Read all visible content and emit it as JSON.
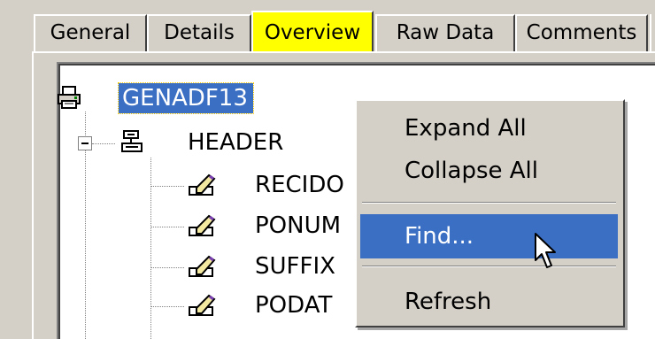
{
  "tabs": [
    {
      "label": "General"
    },
    {
      "label": "Details"
    },
    {
      "label": "Overview",
      "active": true
    },
    {
      "label": "Raw Data"
    },
    {
      "label": "Comments"
    }
  ],
  "tree": {
    "root": {
      "label": "GENADF13",
      "icon": "printer-icon",
      "selected": true
    },
    "header": {
      "label": "HEADER",
      "icon": "record-group-icon",
      "expanded": true
    },
    "fields": [
      {
        "label": "RECIDO",
        "icon": "field-edit-icon"
      },
      {
        "label": "PONUM",
        "icon": "field-edit-icon"
      },
      {
        "label": "SUFFIX",
        "icon": "field-edit-icon"
      },
      {
        "label": "PODAT",
        "icon": "field-edit-icon"
      }
    ]
  },
  "context_menu": {
    "items": [
      {
        "label": "Expand All"
      },
      {
        "label": "Collapse All"
      },
      {
        "label": "Find...",
        "highlighted": true
      },
      {
        "label": "Refresh"
      }
    ]
  },
  "colors": {
    "window_bg": "#d4d0c8",
    "active_tab": "#ffff00",
    "selection": "#3a6fc4",
    "tree_bg": "#ffffff"
  }
}
